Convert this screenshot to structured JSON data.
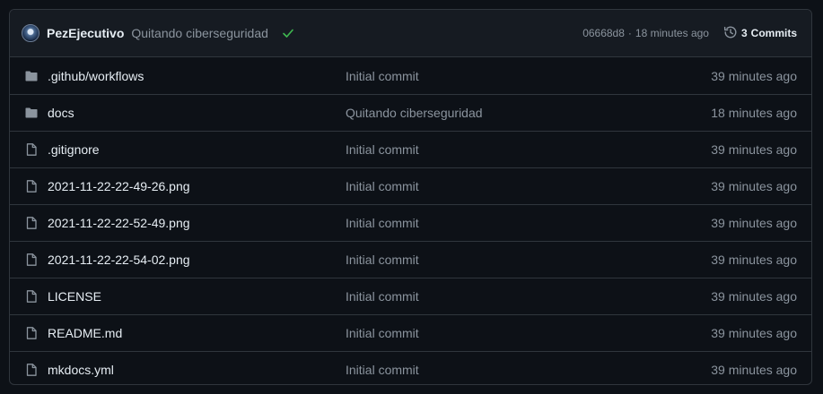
{
  "header": {
    "author": "PezEjecutivo",
    "message": "Quitando ciberseguridad",
    "status_icon": "check-icon",
    "status_color": "#3fb950",
    "commit_hash": "06668d8",
    "separator": "·",
    "commit_time": "18 minutes ago",
    "commits_count": "3",
    "commits_label": "Commits"
  },
  "files": [
    {
      "type": "directory",
      "icon": "folder-icon",
      "name": ".github/workflows",
      "message": "Initial commit",
      "time": "39 minutes ago"
    },
    {
      "type": "directory",
      "icon": "folder-icon",
      "name": "docs",
      "message": "Quitando ciberseguridad",
      "time": "18 minutes ago"
    },
    {
      "type": "file",
      "icon": "file-icon",
      "name": ".gitignore",
      "message": "Initial commit",
      "time": "39 minutes ago"
    },
    {
      "type": "file",
      "icon": "file-icon",
      "name": "2021-11-22-22-49-26.png",
      "message": "Initial commit",
      "time": "39 minutes ago"
    },
    {
      "type": "file",
      "icon": "file-icon",
      "name": "2021-11-22-22-52-49.png",
      "message": "Initial commit",
      "time": "39 minutes ago"
    },
    {
      "type": "file",
      "icon": "file-icon",
      "name": "2021-11-22-22-54-02.png",
      "message": "Initial commit",
      "time": "39 minutes ago"
    },
    {
      "type": "file",
      "icon": "file-icon",
      "name": "LICENSE",
      "message": "Initial commit",
      "time": "39 minutes ago"
    },
    {
      "type": "file",
      "icon": "file-icon",
      "name": "README.md",
      "message": "Initial commit",
      "time": "39 minutes ago"
    },
    {
      "type": "file",
      "icon": "file-icon",
      "name": "mkdocs.yml",
      "message": "Initial commit",
      "time": "39 minutes ago"
    }
  ]
}
